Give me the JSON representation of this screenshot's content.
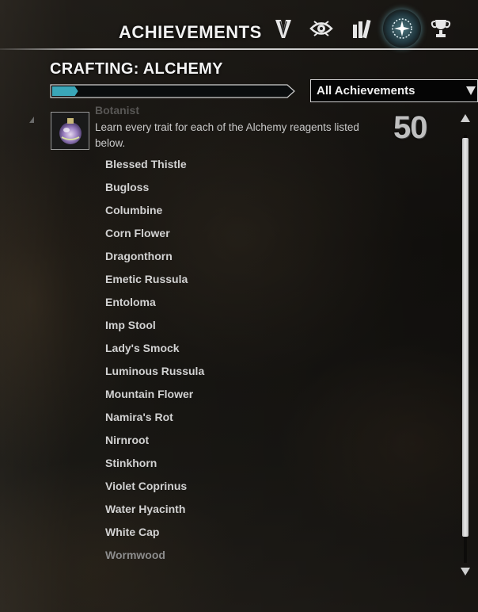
{
  "header": {
    "title": "ACHIEVEMENTS",
    "tabs": [
      {
        "icon": "chevron-badge-icon",
        "active": false
      },
      {
        "icon": "eye-icon",
        "active": false
      },
      {
        "icon": "books-icon",
        "active": false
      },
      {
        "icon": "achievements-star-icon",
        "active": true
      },
      {
        "icon": "trophy-icon",
        "active": false
      }
    ]
  },
  "category": {
    "title": "CRAFTING: ALCHEMY",
    "progress_fraction": 0.1
  },
  "filter": {
    "selected": "All Achievements"
  },
  "achievement": {
    "name": "Botanist",
    "description": "Learn every trait for each of the Alchemy reagents listed below.",
    "points": "50",
    "icon": "alchemy-potion-icon",
    "criteria": [
      "Blessed Thistle",
      "Bugloss",
      "Columbine",
      "Corn Flower",
      "Dragonthorn",
      "Emetic Russula",
      "Entoloma",
      "Imp Stool",
      "Lady's Smock",
      "Luminous Russula",
      "Mountain Flower",
      "Namira's Rot",
      "Nirnroot",
      "Stinkhorn",
      "Violet Coprinus",
      "Water Hyacinth",
      "White Cap",
      "Wormwood"
    ]
  },
  "colors": {
    "progress_fill": "#3aa6b8",
    "active_tab_glow": "#78c8dc"
  }
}
